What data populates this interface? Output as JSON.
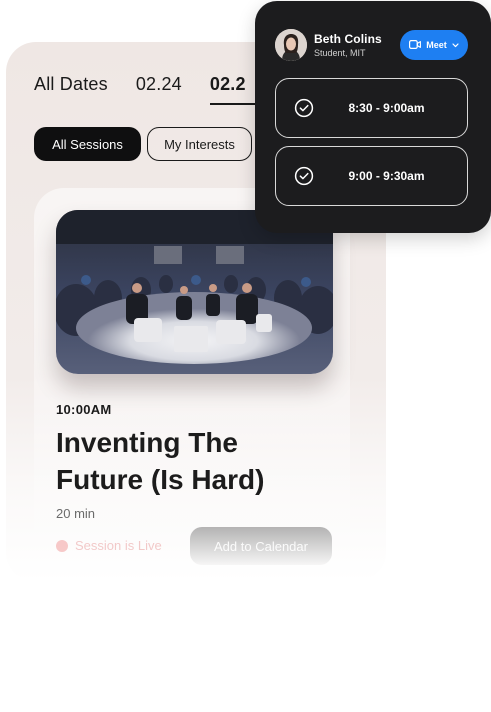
{
  "schedule": {
    "date_tabs": [
      {
        "label": "All Dates"
      },
      {
        "label": "02.24"
      },
      {
        "label": "02.2"
      }
    ],
    "filters": [
      {
        "label": "All Sessions"
      },
      {
        "label": "My Interests"
      }
    ],
    "session": {
      "time": "10:00AM",
      "title": "Inventing The Future (Is Hard)",
      "duration": "20 min",
      "live_status": "Session is Live",
      "add_button": "Add to Calendar"
    }
  },
  "meeting_popup": {
    "user_name": "Beth Colins",
    "user_role": "Student, MIT",
    "meet_button": "Meet",
    "slots": [
      {
        "label": "8:30 - 9:00am"
      },
      {
        "label": "9:00 - 9:30am"
      }
    ]
  },
  "colors": {
    "accent_blue": "#1e7ff2",
    "dark_card": "#1c1c1e",
    "card_background": "#efe7e4",
    "live_dot": "#f08a8a"
  },
  "icons": {
    "camera": "video-camera-icon",
    "chevron": "chevron-down-icon",
    "check": "check-circle-icon"
  }
}
